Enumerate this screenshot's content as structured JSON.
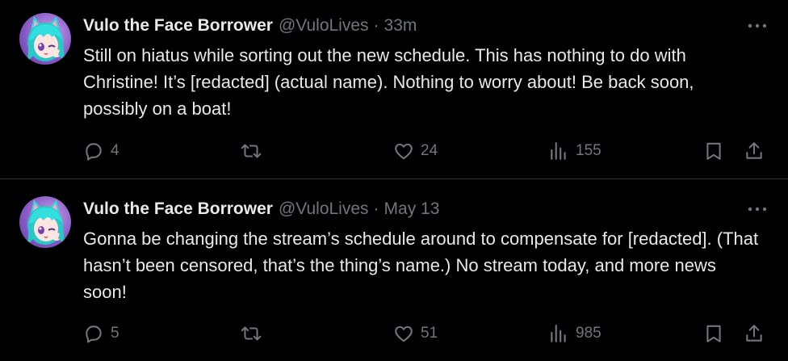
{
  "tweets": [
    {
      "display_name": "Vulo the Face Borrower",
      "handle": "@VuloLives",
      "separator": "·",
      "time": "33m",
      "text": "Still on hiatus while sorting out the new schedule. This has nothing to do with Christine! It’s [redacted] (actual name). Nothing to worry about! Be back soon, possibly on a boat!",
      "replies": "4",
      "retweets": "",
      "likes": "24",
      "views": "155"
    },
    {
      "display_name": "Vulo the Face Borrower",
      "handle": "@VuloLives",
      "separator": "·",
      "time": "May 13",
      "text": "Gonna be changing the stream’s schedule around to compensate for [redacted]. (That hasn’t been censored, that’s the thing’s name.) No stream today, and more news soon!",
      "replies": "5",
      "retweets": "",
      "likes": "51",
      "views": "985"
    }
  ],
  "icons": {
    "more": "more-horizontal-icon",
    "reply": "reply-bubble-icon",
    "retweet": "retweet-icon",
    "like": "heart-icon",
    "views": "bar-chart-icon",
    "bookmark": "bookmark-icon",
    "share": "share-upload-icon"
  },
  "colors": {
    "background": "#000000",
    "primary_text": "#e7e9ea",
    "secondary_text": "#71767b",
    "divider": "#2f3336",
    "avatar_hair": "#2fd6d6",
    "avatar_bg": "#8a5cc8"
  }
}
